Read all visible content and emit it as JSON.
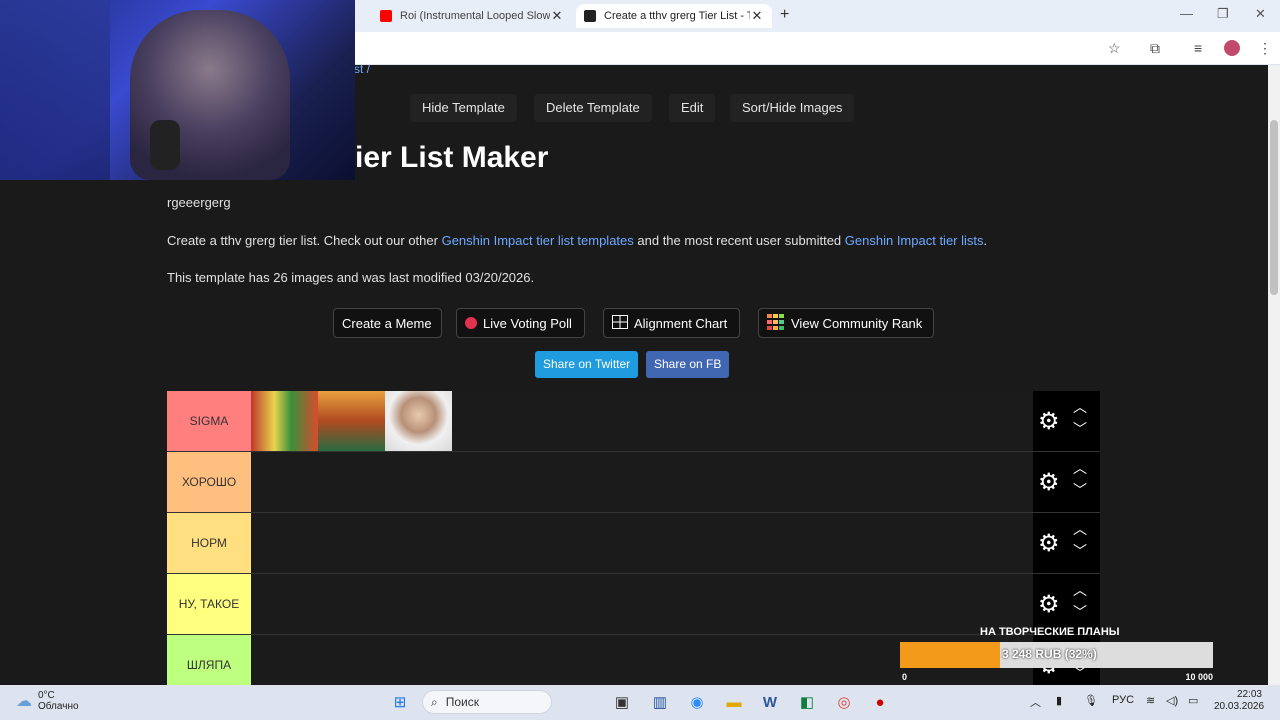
{
  "browser": {
    "tabs": [
      {
        "label": "Roi (Instrumental Looped Slowe"
      },
      {
        "label": "Create a tthv grerg Tier List - Ti"
      }
    ],
    "new_tab": "+"
  },
  "page": {
    "breadcrumb": "st /",
    "top_buttons": [
      "Hide Template",
      "Delete Template",
      "Edit",
      "Sort/Hide Images"
    ],
    "title": "ier List Maker",
    "subtitle": "rgeeergerg",
    "desc_part1": "Create a tthv grerg tier list. Check out our other ",
    "desc_link1": "Genshin Impact tier list templates",
    "desc_part2": " and the most recent user submitted ",
    "desc_link2": "Genshin Impact tier lists",
    "desc_part3": ".",
    "meta": "This template has 26 images and was last modified 03/20/2026.",
    "actions": [
      "Create a Meme",
      "Live Voting Poll",
      "Alignment Chart",
      "View Community Rank"
    ],
    "share": {
      "twitter": "Share on Twitter",
      "fb": "Share on FB"
    }
  },
  "tiers": [
    {
      "label": "SIGMA",
      "color": "#ff7f7f"
    },
    {
      "label": "ХОРОШО",
      "color": "#ffbf7f"
    },
    {
      "label": "НОРМ",
      "color": "#ffdf7f"
    },
    {
      "label": "НУ, ТАКОЕ",
      "color": "#ffff7f"
    },
    {
      "label": "ШЛЯПА",
      "color": "#bfff7f"
    }
  ],
  "donation": {
    "title": "НА ТВОРЧЕСКИЕ ПЛАНЫ",
    "amount": "3 248 RUB (32%)",
    "progress": 0.32,
    "min": "0",
    "max": "10 000"
  },
  "taskbar": {
    "temp": "0°C",
    "weather": "Облачно",
    "search": "Поиск",
    "lang": "РУС",
    "time": "22:03",
    "date": "20.03.2026"
  }
}
